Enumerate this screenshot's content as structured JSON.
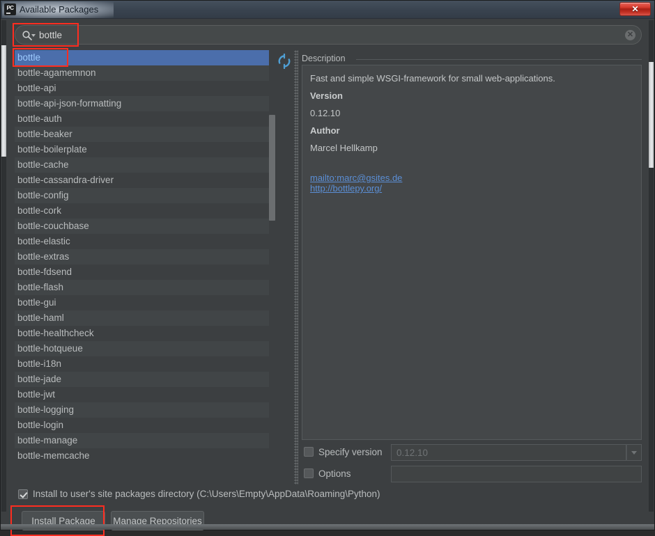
{
  "window": {
    "title": "Available Packages",
    "app_icon": "pycharm-icon",
    "close_label": "✕"
  },
  "search": {
    "value": "bottle",
    "placeholder": "",
    "icon": "search-icon",
    "clear_icon": "✕"
  },
  "packages": {
    "selected": "bottle",
    "items": [
      "bottle",
      "bottle-agamemnon",
      "bottle-api",
      "bottle-api-json-formatting",
      "bottle-auth",
      "bottle-beaker",
      "bottle-boilerplate",
      "bottle-cache",
      "bottle-cassandra-driver",
      "bottle-config",
      "bottle-cork",
      "bottle-couchbase",
      "bottle-elastic",
      "bottle-extras",
      "bottle-fdsend",
      "bottle-flash",
      "bottle-gui",
      "bottle-haml",
      "bottle-healthcheck",
      "bottle-hotqueue",
      "bottle-i18n",
      "bottle-jade",
      "bottle-jwt",
      "bottle-logging",
      "bottle-login",
      "bottle-manage",
      "bottle-memcache"
    ]
  },
  "refresh": {
    "icon": "refresh-icon"
  },
  "description": {
    "label": "Description",
    "summary": "Fast and simple WSGI-framework for small web-applications.",
    "version_heading": "Version",
    "version_value": "0.12.10",
    "author_heading": "Author",
    "author_value": "Marcel Hellkamp",
    "links": [
      "mailto:marc@gsites.de",
      "http://bottlepy.org/"
    ]
  },
  "options": {
    "specify_version_label": "Specify version",
    "specify_version_value": "0.12.10",
    "specify_version_checked": false,
    "options_label": "Options",
    "options_value": "",
    "options_checked": false,
    "dropdown_icon": "chevron-down-icon"
  },
  "footer": {
    "install_user_label": "Install to user's site packages directory (C:\\Users\\Empty\\AppData\\Roaming\\Python)",
    "install_user_checked": true,
    "install_button": "Install Package",
    "manage_button": "Manage Repositories"
  },
  "colors": {
    "accent_selection": "#4b6eab",
    "annotation": "#ff2d20",
    "link": "#5b8fd6",
    "panel_bg": "#3c3f41",
    "desc_bg": "#444749"
  }
}
